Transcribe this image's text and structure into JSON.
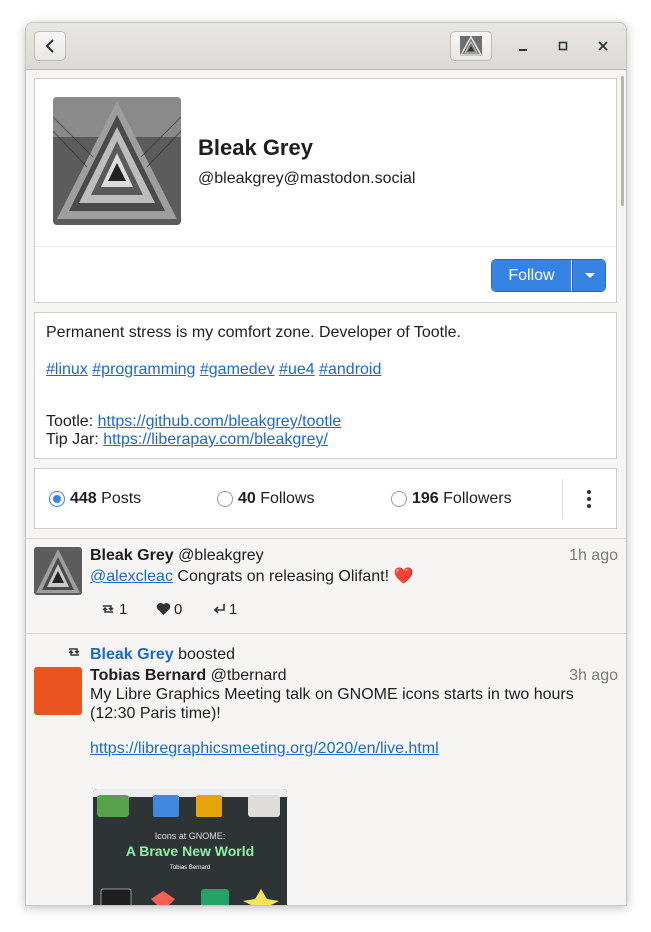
{
  "header": {
    "back_icon": "go-previous-icon",
    "profile_button_icon": "account-avatar-icon",
    "window_controls": [
      "minimize-icon",
      "maximize-icon",
      "close-icon"
    ]
  },
  "profile": {
    "display_name": "Bleak Grey",
    "handle": "@bleakgrey@mastodon.social",
    "follow_label": "Follow"
  },
  "bio": {
    "line1": "Permanent stress is my comfort zone. Developer of Tootle.",
    "hashtags": [
      "#linux",
      "#programming",
      "#gamedev",
      "#ue4",
      "#android"
    ],
    "tootle_label": "Tootle: ",
    "tootle_link": "https://github.com/bleakgrey/tootle",
    "tipjar_label": "Tip Jar: ",
    "tipjar_link": "https://liberapay.com/bleakgrey/"
  },
  "stats": {
    "posts_count": "448",
    "posts_label": "Posts",
    "follows_count": "40",
    "follows_label": "Follows",
    "followers_count": "196",
    "followers_label": "Followers",
    "selected": "Posts"
  },
  "toots": [
    {
      "author": "Bleak Grey",
      "handle": "@bleakgrey",
      "time": "1h ago",
      "mention": "@alexcleac",
      "text": " Congrats on releasing Olifant! ❤️",
      "reblogs": "1",
      "favourites": "0",
      "replies": "1"
    },
    {
      "boosted_by": "Bleak Grey",
      "boosted_label": "boosted",
      "author": "Tobias Bernard",
      "handle": "@tbernard",
      "time": "3h ago",
      "text": "My Libre Graphics Meeting talk on GNOME icons starts in two hours (12:30 Paris time)!",
      "link": "https://libregraphicsmeeting.org/2020/en/live.html",
      "preview_title_small": "Icons at GNOME:",
      "preview_title": "A Brave New World",
      "preview_author": "Tobias Bernard",
      "avatar_color": "#e95420"
    }
  ]
}
